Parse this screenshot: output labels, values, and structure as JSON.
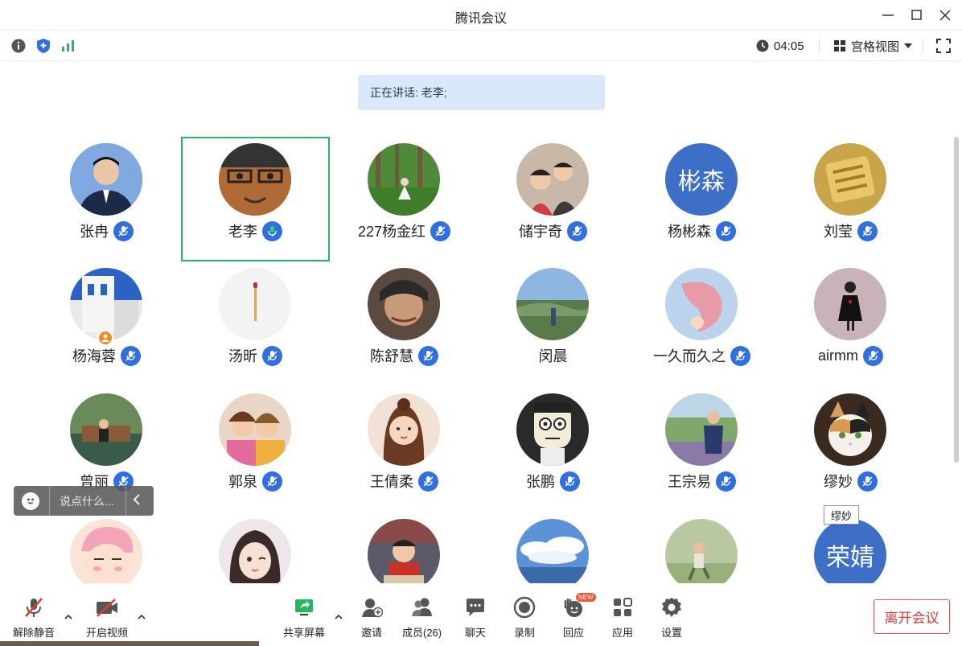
{
  "window": {
    "title": "腾讯会议"
  },
  "status": {
    "timer": "04:05",
    "view_label": "宫格视图"
  },
  "speaking": "正在讲话: 老李;",
  "participants": [
    {
      "name": "张冉",
      "avatar_text": ""
    },
    {
      "name": "老李",
      "avatar_text": ""
    },
    {
      "name": "227杨金红",
      "avatar_text": ""
    },
    {
      "name": "储宇奇",
      "avatar_text": ""
    },
    {
      "name": "杨彬森",
      "avatar_text": "彬森"
    },
    {
      "name": "刘莹",
      "avatar_text": ""
    },
    {
      "name": "杨海蓉",
      "avatar_text": ""
    },
    {
      "name": "汤昕",
      "avatar_text": ""
    },
    {
      "name": "陈舒慧",
      "avatar_text": ""
    },
    {
      "name": "闵晨",
      "avatar_text": ""
    },
    {
      "name": "一久而久之",
      "avatar_text": ""
    },
    {
      "name": "airmm",
      "avatar_text": ""
    },
    {
      "name": "曾丽",
      "avatar_text": ""
    },
    {
      "name": "郭泉",
      "avatar_text": ""
    },
    {
      "name": "王倩柔",
      "avatar_text": ""
    },
    {
      "name": "张鹏",
      "avatar_text": ""
    },
    {
      "name": "王宗易",
      "avatar_text": ""
    },
    {
      "name": "缪妙",
      "avatar_text": ""
    },
    {
      "name": "",
      "avatar_text": ""
    },
    {
      "name": "",
      "avatar_text": ""
    },
    {
      "name": "",
      "avatar_text": ""
    },
    {
      "name": "",
      "avatar_text": ""
    },
    {
      "name": "",
      "avatar_text": ""
    },
    {
      "name": "",
      "avatar_text": "荣婧"
    }
  ],
  "tooltip": "缪妙",
  "chat": {
    "placeholder": "说点什么..."
  },
  "toolbar": {
    "unmute": "解除静音",
    "start_video": "开启视频",
    "share": "共享屏幕",
    "invite": "邀请",
    "members": "成员(26)",
    "chat": "聊天",
    "record": "录制",
    "react": "回应",
    "react_badge": "NEW",
    "apps": "应用",
    "settings": "设置",
    "leave": "离开会议"
  },
  "colors": {
    "accent_blue": "#2f6fe0",
    "active_border": "#27b760",
    "leave_red": "#d93c3c",
    "avatar_blue": "#3d6fc6"
  }
}
